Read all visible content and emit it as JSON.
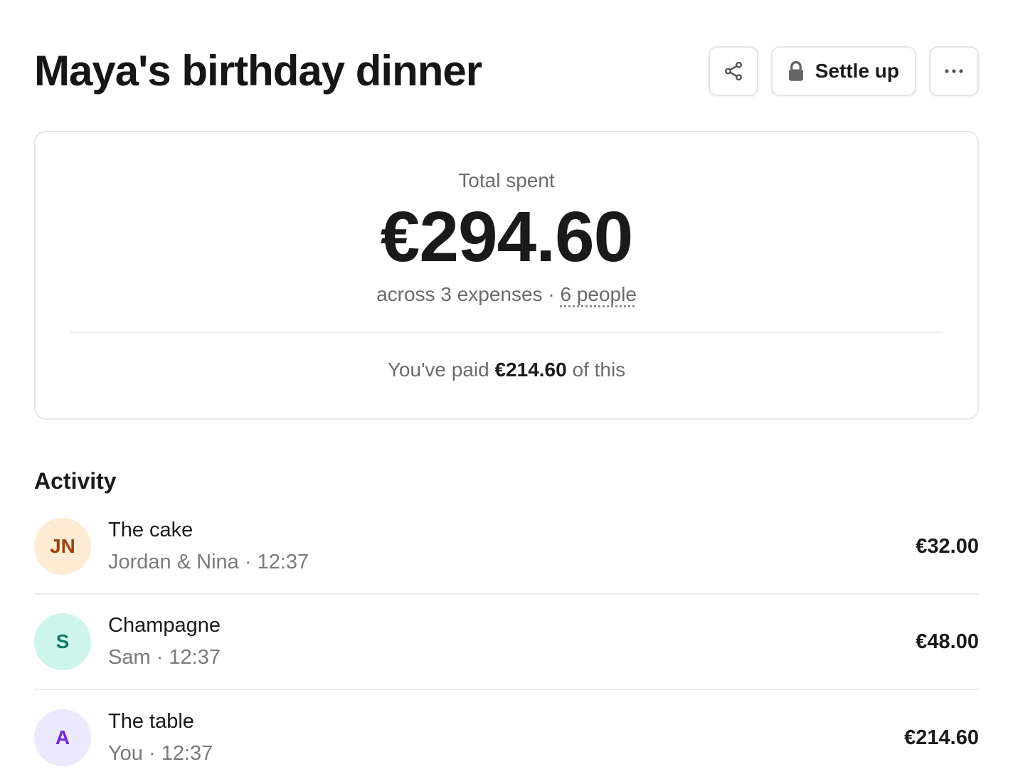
{
  "header": {
    "title": "Maya's birthday dinner",
    "share_icon": "share-icon",
    "settle_label": "Settle up",
    "settle_icon": "lock-icon",
    "more_icon": "more-horizontal-icon"
  },
  "summary": {
    "total_label": "Total spent",
    "total_amount": "€294.60",
    "expenses_text": "across 3 expenses",
    "separator": " · ",
    "people_text": "6 people",
    "paid_prefix": "You've paid ",
    "paid_amount": "€214.60",
    "paid_suffix": " of this"
  },
  "activity": {
    "title": "Activity",
    "items": [
      {
        "initials": "JN",
        "name": "The cake",
        "payer": "Jordan & Nina",
        "time": "12:37",
        "amount": "€32.00",
        "avatar_bg": "#fdebd3",
        "avatar_fg": "#a0400e"
      },
      {
        "initials": "S",
        "name": "Champagne",
        "payer": "Sam",
        "time": "12:37",
        "amount": "€48.00",
        "avatar_bg": "#cdf5ec",
        "avatar_fg": "#0f7a66"
      },
      {
        "initials": "A",
        "name": "The table",
        "payer": "You",
        "time": "12:37",
        "amount": "€214.60",
        "avatar_bg": "#ece8fd",
        "avatar_fg": "#6d28d9"
      }
    ],
    "meta_separator": " · "
  }
}
